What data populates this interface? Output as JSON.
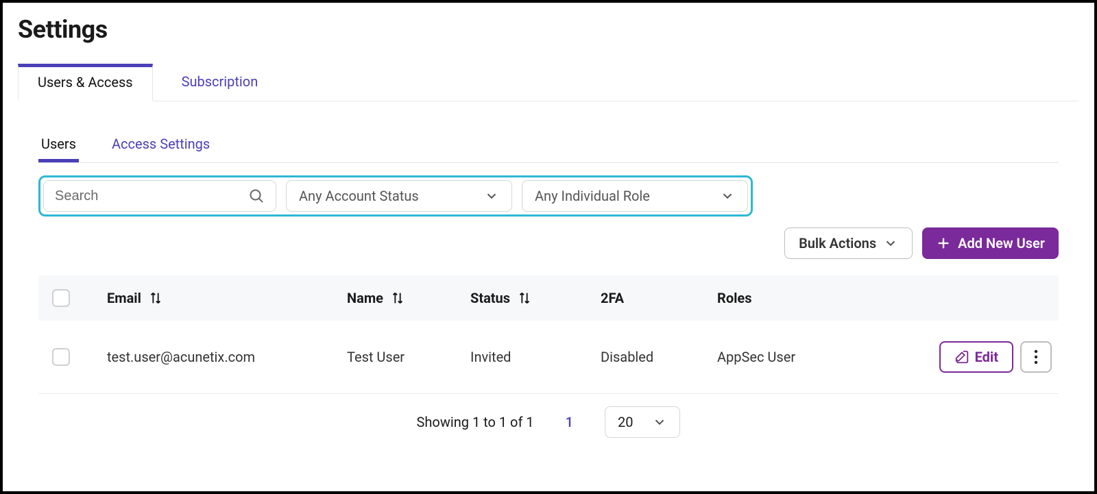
{
  "page": {
    "title": "Settings"
  },
  "topTabs": [
    {
      "label": "Users & Access",
      "active": true
    },
    {
      "label": "Subscription",
      "active": false
    }
  ],
  "subTabs": [
    {
      "label": "Users",
      "active": true
    },
    {
      "label": "Access Settings",
      "active": false
    }
  ],
  "filters": {
    "searchPlaceholder": "Search",
    "accountStatus": "Any Account Status",
    "individualRole": "Any Individual Role"
  },
  "actions": {
    "bulk": "Bulk Actions",
    "addUser": "Add New User"
  },
  "table": {
    "headers": {
      "email": "Email",
      "name": "Name",
      "status": "Status",
      "twoFA": "2FA",
      "roles": "Roles"
    },
    "rows": [
      {
        "email": "test.user@acunetix.com",
        "name": "Test User",
        "status": "Invited",
        "twoFA": "Disabled",
        "roles": "AppSec User"
      }
    ],
    "editLabel": "Edit"
  },
  "pagination": {
    "summary": "Showing 1 to 1 of 1",
    "page": "1",
    "pageSize": "20"
  }
}
